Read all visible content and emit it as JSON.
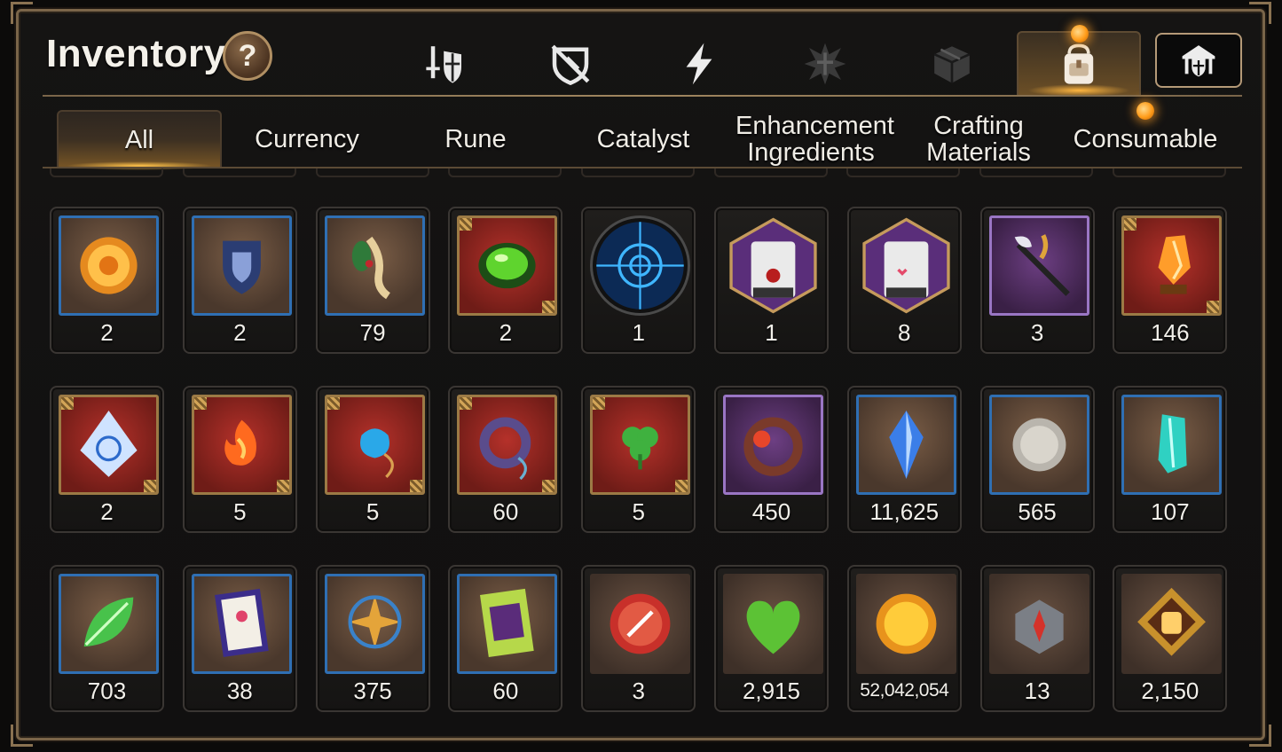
{
  "header": {
    "title": "Inventory",
    "help_label": "?"
  },
  "category_tabs": [
    {
      "name": "equipment",
      "icon": "sword-shield-icon",
      "active": false
    },
    {
      "name": "broken-gear",
      "icon": "broken-shield-icon",
      "active": false
    },
    {
      "name": "skill",
      "icon": "lightning-icon",
      "active": false
    },
    {
      "name": "emblem",
      "icon": "spiked-cross-icon",
      "active": false
    },
    {
      "name": "box",
      "icon": "cube-box-icon",
      "active": false
    },
    {
      "name": "bag",
      "icon": "backpack-icon",
      "active": true
    }
  ],
  "guild_button": {
    "icon": "guild-shield-icon"
  },
  "subtabs": [
    {
      "label": "All",
      "active": true
    },
    {
      "label": "Currency",
      "active": false
    },
    {
      "label": "Rune",
      "active": false
    },
    {
      "label": "Catalyst",
      "active": false
    },
    {
      "label": "Enhancement Ingredients",
      "active": false
    },
    {
      "label": "Crafting Materials",
      "active": false
    },
    {
      "label": "Consumable",
      "active": false
    }
  ],
  "items": [
    {
      "qty": "2",
      "icon": "sun-coin-icon",
      "frame": "blue"
    },
    {
      "qty": "2",
      "icon": "blue-shield-icon",
      "frame": "blue"
    },
    {
      "qty": "79",
      "icon": "ginseng-root-icon",
      "frame": "blue"
    },
    {
      "qty": "2",
      "icon": "green-orb-icon",
      "frame": "red"
    },
    {
      "qty": "1",
      "icon": "blue-rune-circle-icon",
      "frame": "circle"
    },
    {
      "qty": "1",
      "icon": "pet-bag-medal-icon",
      "frame": "hex"
    },
    {
      "qty": "8",
      "icon": "pet-bag-icon",
      "frame": "hex"
    },
    {
      "qty": "3",
      "icon": "feather-wand-icon",
      "frame": "purple"
    },
    {
      "qty": "146",
      "icon": "orange-crystal-icon",
      "frame": "red"
    },
    {
      "qty": "2",
      "icon": "triquetra-gem-icon",
      "frame": "red"
    },
    {
      "qty": "5",
      "icon": "fire-pendant-icon",
      "frame": "red"
    },
    {
      "qty": "5",
      "icon": "water-pendant-icon",
      "frame": "red"
    },
    {
      "qty": "60",
      "icon": "ring-pendant-icon",
      "frame": "red"
    },
    {
      "qty": "5",
      "icon": "clover-pendant-icon",
      "frame": "red"
    },
    {
      "qty": "450",
      "icon": "flower-ring-icon",
      "frame": "purple"
    },
    {
      "qty": "11,625",
      "icon": "blue-crystal-icon",
      "frame": "blue"
    },
    {
      "qty": "565",
      "icon": "silver-coin-icon",
      "frame": "blue"
    },
    {
      "qty": "107",
      "icon": "teal-crystal-icon",
      "frame": "blue"
    },
    {
      "qty": "703",
      "icon": "green-leaf-icon",
      "frame": "blue"
    },
    {
      "qty": "38",
      "icon": "paw-certificate-icon",
      "frame": "blue"
    },
    {
      "qty": "375",
      "icon": "star-pendant-icon",
      "frame": "blue"
    },
    {
      "qty": "60",
      "icon": "green-certificate-icon",
      "frame": "blue"
    },
    {
      "qty": "3",
      "icon": "red-badge-icon",
      "frame": "brown"
    },
    {
      "qty": "2,915",
      "icon": "green-heart-icon",
      "frame": "brown"
    },
    {
      "qty": "52,042,054",
      "icon": "gold-coin-icon",
      "frame": "brown",
      "small": true
    },
    {
      "qty": "13",
      "icon": "stone-compass-icon",
      "frame": "brown"
    },
    {
      "qty": "2,150",
      "icon": "fist-emblem-icon",
      "frame": "brown"
    }
  ],
  "colors": {
    "accent": "#ffb640",
    "frame_border": "#7a6549",
    "blue_frame": "#2f6fb3",
    "red_frame": "#9c7a45",
    "purple_frame": "#9a76c4"
  }
}
